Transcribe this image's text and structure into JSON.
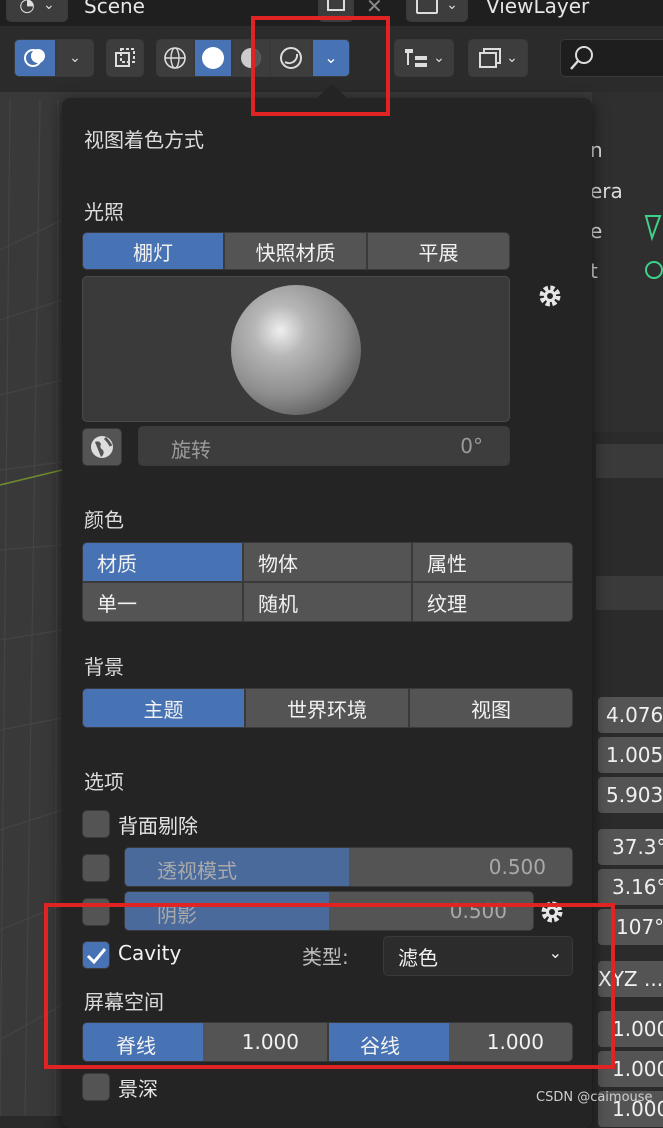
{
  "topbar": {
    "scene_label": "Scene",
    "view_layer_label": "ViewLayer",
    "close_glyph": "✕"
  },
  "header": {
    "shading_dropdown_glyph": "⌄"
  },
  "right_panel": {
    "outliner_fragments": [
      "n",
      "era",
      "e",
      "t"
    ],
    "values": [
      "4.076",
      "1.005",
      "5.903",
      "37.3°",
      "3.16°",
      "107°"
    ],
    "rotation_mode": "XYZ ...",
    "scale_values": [
      "1.000",
      "1.000",
      "1.000"
    ]
  },
  "popup": {
    "title": "视图着色方式",
    "lighting": {
      "label": "光照",
      "options": [
        "棚灯",
        "快照材质",
        "平展"
      ],
      "selected": 0,
      "rotation_label": "旋转",
      "rotation_value": "0°"
    },
    "color": {
      "label": "颜色",
      "options": [
        "材质",
        "物体",
        "属性",
        "单一",
        "随机",
        "纹理"
      ],
      "selected": 0
    },
    "background": {
      "label": "背景",
      "options": [
        "主题",
        "世界环境",
        "视图"
      ],
      "selected": 0
    },
    "options": {
      "label": "选项",
      "backface_culling": {
        "label": "背面剔除",
        "checked": false
      },
      "xray": {
        "label": "透视模式",
        "value": "0.500",
        "fraction": 0.5,
        "checked": false
      },
      "shadow": {
        "label": "阴影",
        "value": "0.500",
        "fraction": 0.5,
        "checked": false
      },
      "cavity": {
        "label": "Cavity",
        "checked": true,
        "type_label": "类型:",
        "type_value": "滤色"
      },
      "screen_space": {
        "label": "屏幕空间"
      },
      "ridge": {
        "label": "脊线",
        "value": "1.000"
      },
      "valley": {
        "label": "谷线",
        "value": "1.000"
      },
      "dof": {
        "label": "景深",
        "checked": false
      }
    }
  },
  "watermark": "CSDN @caimouse",
  "colors": {
    "accent": "#4772b3",
    "highlight": "#e02424",
    "panel_bg": "#242424",
    "button_bg": "#545454"
  }
}
